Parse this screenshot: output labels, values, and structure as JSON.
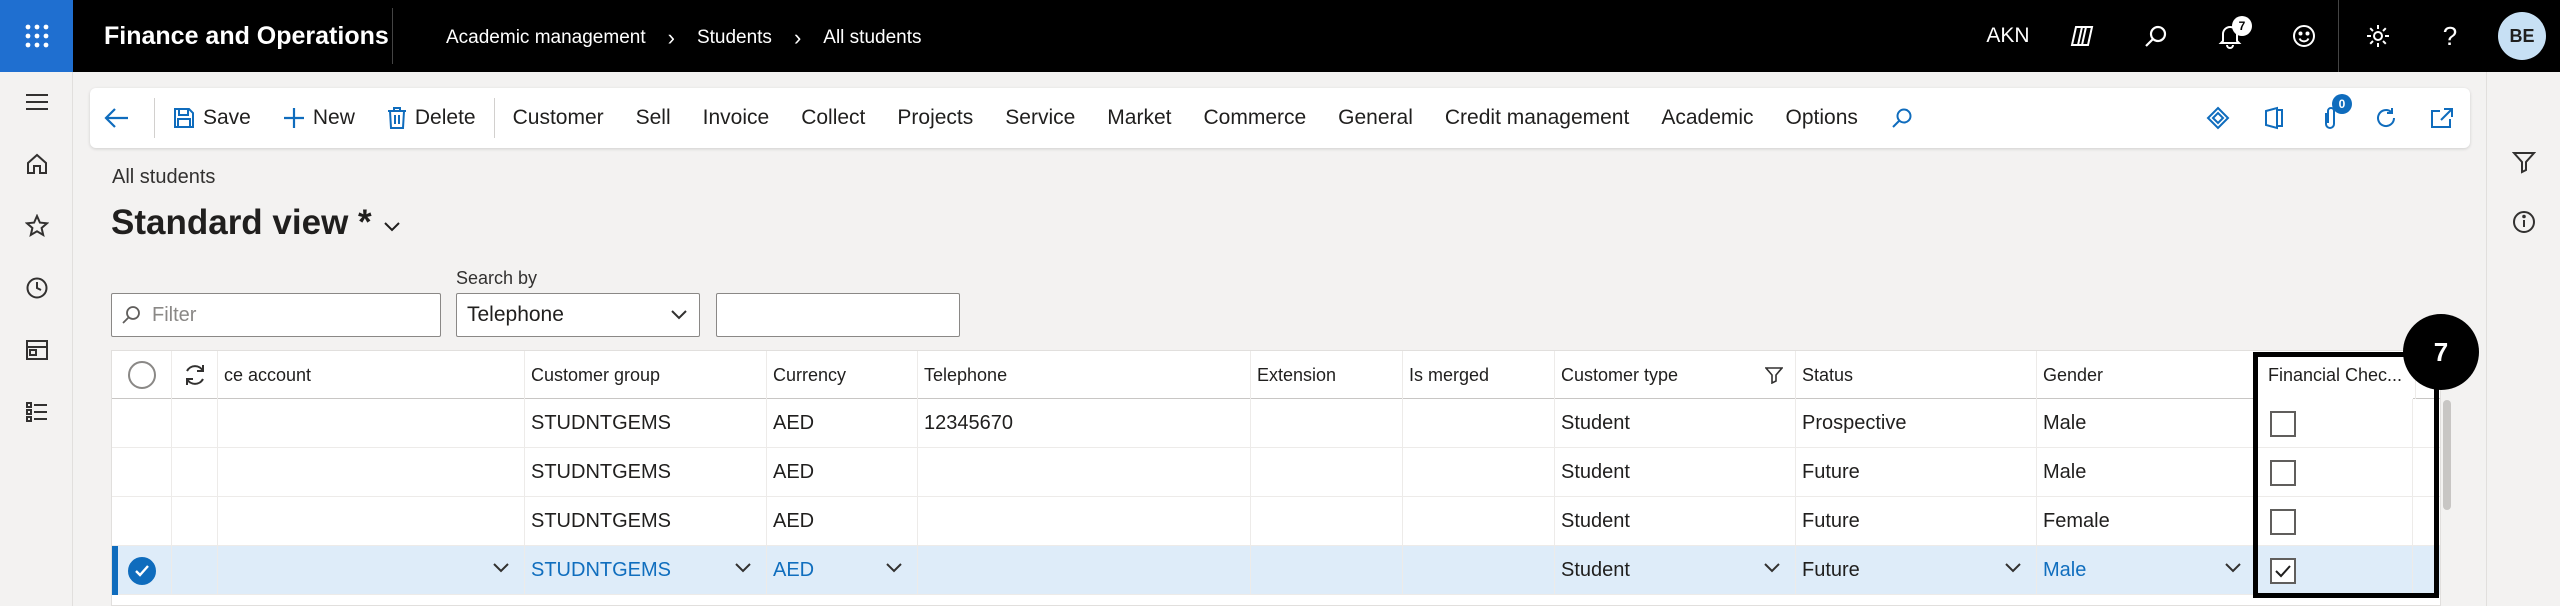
{
  "app": {
    "title": "Finance and Operations",
    "company": "AKN",
    "notifications_count": "7",
    "avatar_initials": "BE"
  },
  "breadcrumb": [
    "Academic management",
    "Students",
    "All students"
  ],
  "action_pane": {
    "save": "Save",
    "new": "New",
    "delete": "Delete",
    "menus": [
      "Customer",
      "Sell",
      "Invoice",
      "Collect",
      "Projects",
      "Service",
      "Market",
      "Commerce",
      "General",
      "Credit management",
      "Academic",
      "Options"
    ],
    "attachments_count": "0"
  },
  "page": {
    "caption": "All students",
    "view_name": "Standard view *"
  },
  "filters": {
    "filter_placeholder": "Filter",
    "search_by_label": "Search by",
    "search_by_value": "Telephone",
    "search_value": ""
  },
  "grid": {
    "columns": [
      "ce account",
      "Customer group",
      "Currency",
      "Telephone",
      "Extension",
      "Is merged",
      "Customer type",
      "Status",
      "Gender",
      "Financial Chec..."
    ],
    "rows": [
      {
        "account": "",
        "customer_group": "STUDNTGEMS",
        "currency": "AED",
        "telephone": "12345670",
        "extension": "",
        "is_merged": "",
        "customer_type": "Student",
        "status": "Prospective",
        "gender": "Male",
        "financial_check": false,
        "selected": false
      },
      {
        "account": "",
        "customer_group": "STUDNTGEMS",
        "currency": "AED",
        "telephone": "",
        "extension": "",
        "is_merged": "",
        "customer_type": "Student",
        "status": "Future",
        "gender": "Male",
        "financial_check": false,
        "selected": false
      },
      {
        "account": "",
        "customer_group": "STUDNTGEMS",
        "currency": "AED",
        "telephone": "",
        "extension": "",
        "is_merged": "",
        "customer_type": "Student",
        "status": "Future",
        "gender": "Female",
        "financial_check": false,
        "selected": false
      },
      {
        "account": "",
        "customer_group": "STUDNTGEMS",
        "currency": "AED",
        "telephone": "",
        "extension": "",
        "is_merged": "",
        "customer_type": "Student",
        "status": "Future",
        "gender": "Male",
        "financial_check": true,
        "selected": true
      }
    ]
  },
  "annotation": {
    "step_number": "7"
  },
  "colors": {
    "accent": "#0f6cbd",
    "waffle_bg": "#1f6fd0",
    "selected_row": "#deecf9"
  }
}
